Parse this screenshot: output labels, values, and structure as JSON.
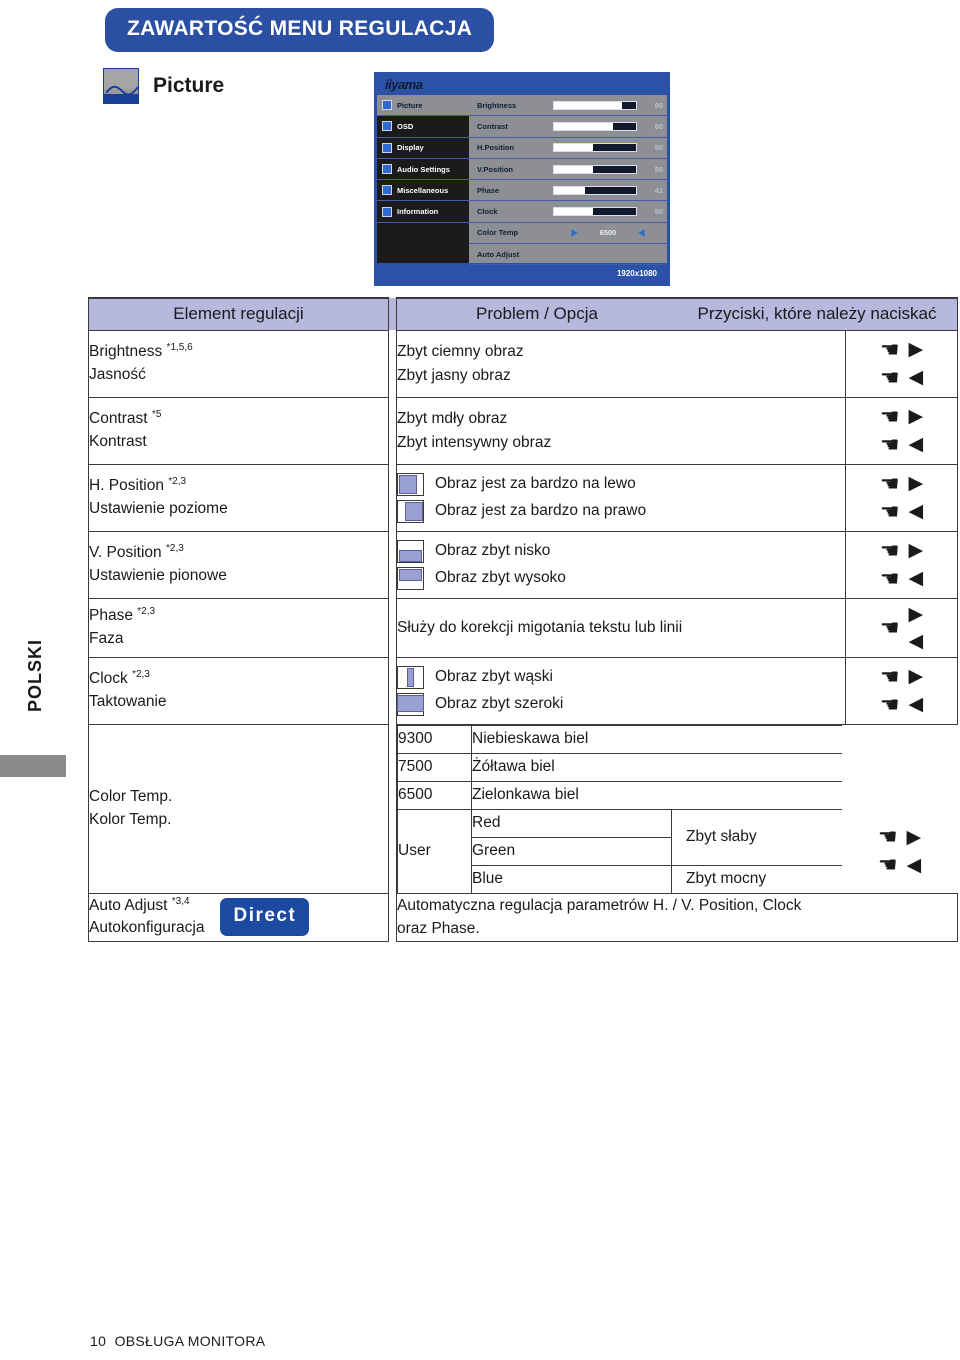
{
  "page": {
    "title": "ZAWARTOŚĆ MENU REGULACJA",
    "section_heading": "Picture",
    "section_icon": "picture-icon",
    "side_tab": "POLSKI",
    "footer_page": "10",
    "footer_text": "OBSŁUGA MONITORA",
    "accent_blue": "#2b4fa2",
    "header_fill": "#b6b8dd",
    "option_fill": "#9ba0d4"
  },
  "osd": {
    "brand": "iiyama",
    "resolution": "1920x1080",
    "sidebar": [
      {
        "label": "Picture",
        "selected": true
      },
      {
        "label": "OSD",
        "selected": false
      },
      {
        "label": "Display",
        "selected": false
      },
      {
        "label": "Audio Settings",
        "selected": false
      },
      {
        "label": "Miscellaneous",
        "selected": false
      },
      {
        "label": "Information",
        "selected": false
      }
    ],
    "rows": [
      {
        "name": "Brightness",
        "value": "90",
        "fill": 83
      },
      {
        "name": "Contrast",
        "value": "80",
        "fill": 72
      },
      {
        "name": "H.Position",
        "value": "50",
        "fill": 48
      },
      {
        "name": "V.Position",
        "value": "50",
        "fill": 48
      },
      {
        "name": "Phase",
        "value": "41",
        "fill": 38
      },
      {
        "name": "Clock",
        "value": "50",
        "fill": 48
      }
    ],
    "color_temp": {
      "name": "Color Temp",
      "value": "6500",
      "left_arrow": "◀",
      "right_arrow": "▶"
    },
    "auto_adjust": {
      "name": "Auto Adjust"
    }
  },
  "table": {
    "headers": {
      "col1": "Element regulacji",
      "col2": "Problem / Opcja",
      "col3": "Przyciski, które należy naciskać"
    },
    "rows": [
      {
        "en": "Brightness",
        "notes": "1,5,6",
        "pl": "Jasność",
        "opt1": "Zbyt ciemny obraz",
        "opt2": "Zbyt jasny obraz",
        "btn1_hand": "☚",
        "btn1_tri": "▶",
        "btn2_hand": "☚",
        "btn2_tri": "◀"
      },
      {
        "en": "Contrast",
        "notes": "5",
        "pl": "Kontrast",
        "opt1": "Zbyt mdły obraz",
        "opt2": "Zbyt intensywny obraz",
        "btn1_hand": "☚",
        "btn1_tri": "▶",
        "btn2_hand": "☚",
        "btn2_tri": "◀"
      },
      {
        "en": "H. Position",
        "notes": "2,3",
        "pl": "Ustawienie poziome",
        "opt1": "Obraz jest za bardzo na lewo",
        "opt2": "Obraz jest za bardzo na prawo",
        "icon1": "picture-shifted-left-icon",
        "icon2": "picture-shifted-right-icon",
        "btn1_hand": "☚",
        "btn1_tri": "▶",
        "btn2_hand": "☚",
        "btn2_tri": "◀"
      },
      {
        "en": "V. Position",
        "notes": "2,3",
        "pl": "Ustawienie pionowe",
        "opt1": "Obraz zbyt nisko",
        "opt2": "Obraz zbyt wysoko",
        "icon1": "picture-shifted-down-icon",
        "icon2": "picture-shifted-up-icon",
        "btn1_hand": "☚",
        "btn1_tri": "▶",
        "btn2_hand": "☚",
        "btn2_tri": "◀"
      },
      {
        "en": "Phase",
        "notes": "2,3",
        "pl": "Faza",
        "desc": "Służy do korekcji migotania tekstu lub linii",
        "btn1_hand": "☚",
        "btn1_tri": "▶",
        "btn2_tri": "◀"
      },
      {
        "en": "Clock",
        "notes": "2,3",
        "pl": "Taktowanie",
        "opt1": "Obraz zbyt wąski",
        "opt2": "Obraz zbyt szeroki",
        "icon1": "picture-too-narrow-icon",
        "icon2": "picture-too-wide-icon",
        "btn1_hand": "☚",
        "btn1_tri": "▶",
        "btn2_hand": "☚",
        "btn2_tri": "◀"
      }
    ],
    "color_temp_row": {
      "en": "Color Temp.",
      "pl": "Kolor Temp.",
      "presets": [
        {
          "value": "9300",
          "label": "Niebieskawa biel"
        },
        {
          "value": "7500",
          "label": "Żółtawa biel"
        },
        {
          "value": "6500",
          "label": "Zielonkawa biel"
        }
      ],
      "user_label": "User",
      "channels": [
        "Red",
        "Green",
        "Blue"
      ],
      "weak": "Zbyt słaby",
      "strong": "Zbyt mocny",
      "btn1_hand": "☚",
      "btn1_tri": "▶",
      "btn2_hand": "☚",
      "btn2_tri": "◀"
    },
    "auto_adjust_row": {
      "en": "Auto Adjust",
      "notes": "3,4",
      "pl": "Autokonfiguracja",
      "badge": "Direct",
      "desc_line1": "Automatyczna regulacja parametrów H. / V. Position, Clock",
      "desc_line2": "oraz Phase."
    }
  }
}
